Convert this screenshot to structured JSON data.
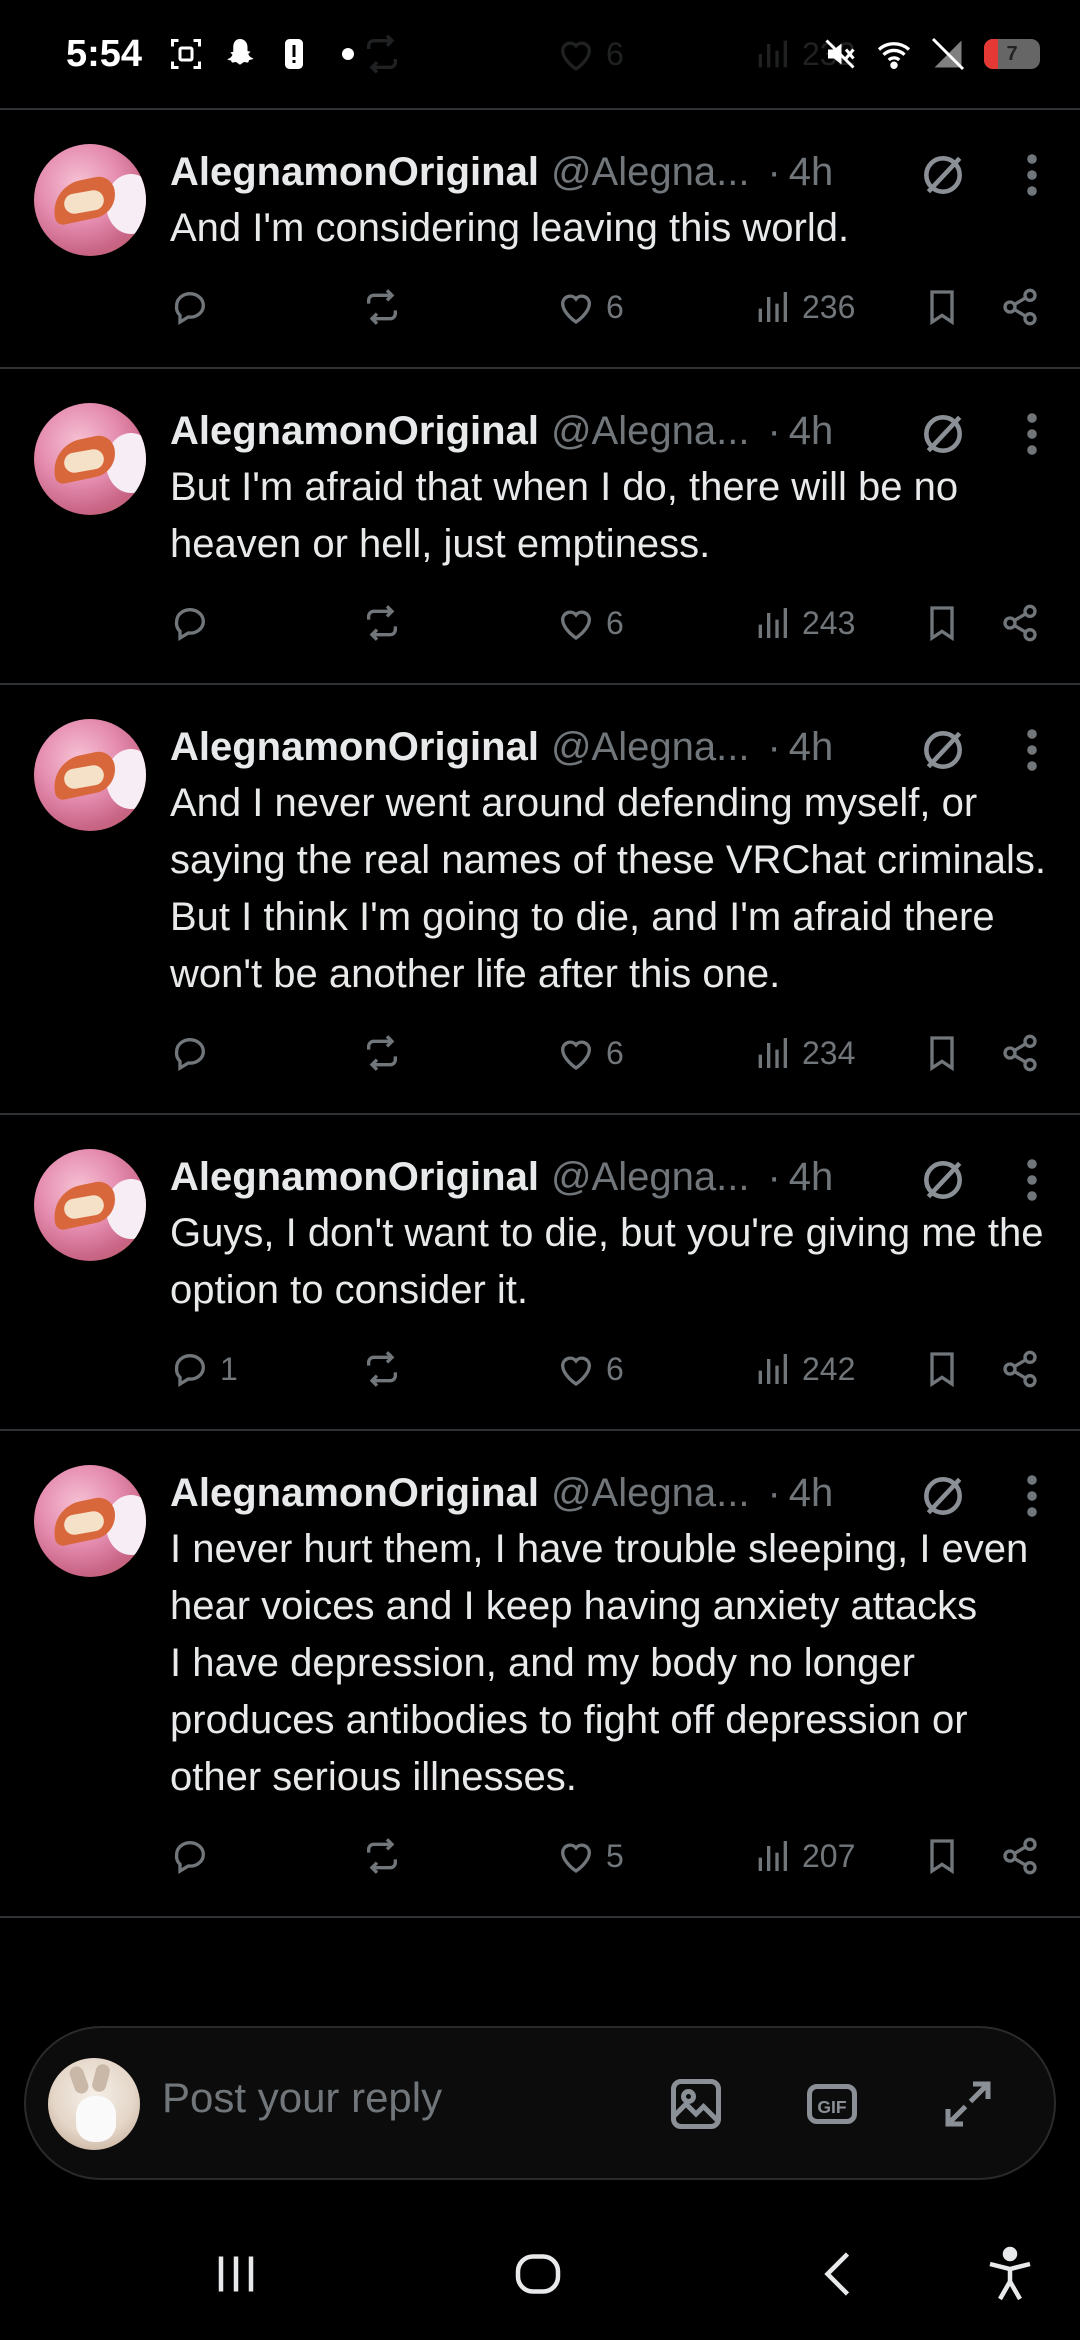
{
  "status_bar": {
    "time": "5:54",
    "battery": "7",
    "ghost": {
      "likes": "6",
      "views": "232"
    }
  },
  "posts": [
    {
      "author": "AlegnamonOriginal",
      "handle": "@Alegna...",
      "separator": "·",
      "time": "4h",
      "text": "And I'm considering leaving this world.",
      "replies": "",
      "likes": "6",
      "views": "236"
    },
    {
      "author": "AlegnamonOriginal",
      "handle": "@Alegna...",
      "separator": "·",
      "time": "4h",
      "text": "But I'm afraid that when I do, there will be no heaven or hell, just emptiness.",
      "replies": "",
      "likes": "6",
      "views": "243"
    },
    {
      "author": "AlegnamonOriginal",
      "handle": "@Alegna...",
      "separator": "·",
      "time": "4h",
      "text": "And I never went around defending myself, or saying the real names of these VRChat criminals. But I think I'm going to die, and I'm afraid there won't be another life after this one.",
      "replies": "",
      "likes": "6",
      "views": "234"
    },
    {
      "author": "AlegnamonOriginal",
      "handle": "@Alegna...",
      "separator": "·",
      "time": "4h",
      "text": "Guys, I don't want to die, but you're giving me the option to consider it.",
      "replies": "1",
      "likes": "6",
      "views": "242"
    },
    {
      "author": "AlegnamonOriginal",
      "handle": "@Alegna...",
      "separator": "·",
      "time": "4h",
      "text": "I never hurt them, I have trouble sleeping, I even hear voices and I keep having anxiety attacks\nI have depression, and my body no longer produces antibodies to fight off depression or other serious illnesses.",
      "replies": "",
      "likes": "5",
      "views": "207"
    }
  ],
  "reply_bar": {
    "placeholder": "Post your reply"
  },
  "icons": {
    "reply": "speech-bubble-icon",
    "repost": "repost-icon",
    "like": "heart-icon",
    "views": "bar-chart-icon",
    "bookmark": "bookmark-icon",
    "share": "share-icon",
    "grok": "grok-icon",
    "more": "vertical-dots-icon"
  },
  "colors": {
    "background": "#000000",
    "text": "#e7e9ea",
    "muted": "#71767b",
    "divider": "#2f3336"
  }
}
